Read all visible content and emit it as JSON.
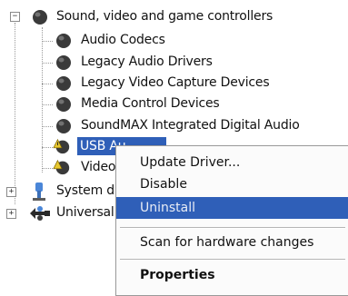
{
  "tree": {
    "category": {
      "label": "Sound, video and game controllers",
      "expander": "−"
    },
    "children": [
      {
        "label": "Audio Codecs"
      },
      {
        "label": "Legacy Audio Drivers"
      },
      {
        "label": "Legacy Video Capture Devices"
      },
      {
        "label": "Media Control Devices"
      },
      {
        "label": "SoundMAX Integrated Digital Audio"
      },
      {
        "label": "USB Au"
      },
      {
        "label": "Video"
      }
    ],
    "others": [
      {
        "label": "System d",
        "expander": "+"
      },
      {
        "label": "Universal",
        "expander": "+"
      }
    ]
  },
  "context_menu": {
    "items": [
      {
        "label": "Update Driver..."
      },
      {
        "label": "Disable"
      },
      {
        "label": "Uninstall"
      },
      {
        "label": "Scan for hardware changes"
      },
      {
        "label": "Properties"
      }
    ]
  },
  "colors": {
    "selection": "#2f5fb8",
    "speaker": "#3c3c3c"
  },
  "icons": {
    "speaker": "speaker-icon",
    "warning": "warning-icon",
    "system": "system-devices-icon",
    "usb": "usb-controller-icon"
  }
}
